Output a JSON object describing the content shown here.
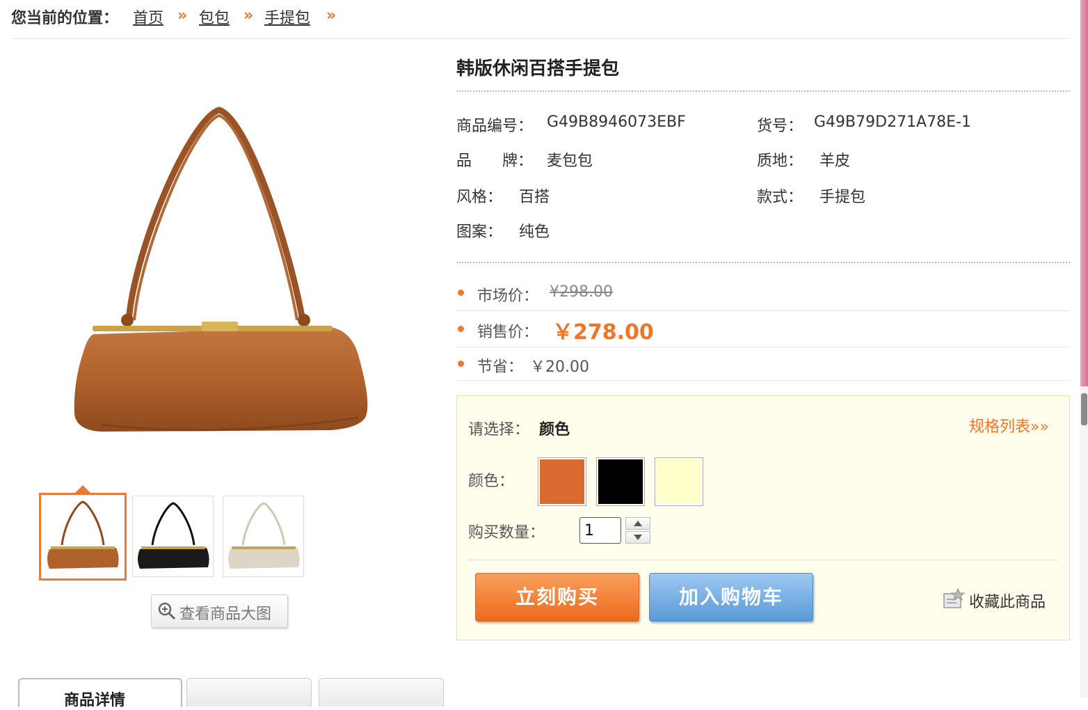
{
  "breadcrumb": {
    "label": "您当前的位置：",
    "items": [
      "首页",
      "包包",
      "手提包"
    ],
    "separator": "»"
  },
  "product": {
    "title": "韩版休闲百搭手提包",
    "attributes": [
      {
        "key": "商品编号：",
        "value": "G49B8946073EBF"
      },
      {
        "key": "货号：",
        "value": "G49B79D271A78E-1"
      },
      {
        "key": "品　　牌：",
        "value": "麦包包"
      },
      {
        "key": "质地：",
        "value": "羊皮"
      },
      {
        "key": "风格：",
        "value": "百搭"
      },
      {
        "key": "款式：",
        "value": "手提包"
      },
      {
        "key": "图案：",
        "value": "纯色"
      }
    ]
  },
  "prices": {
    "market_label": "市场价：",
    "market_value": "¥298.00",
    "sale_label": "销售价：",
    "sale_value": "￥278.00",
    "save_label": "节省：",
    "save_value": "￥20.00"
  },
  "options": {
    "choose_label": "请选择：",
    "choose_value": "颜色",
    "spec_link": "规格列表»»",
    "color_label": "颜色：",
    "colors": [
      "#d96a30",
      "#000000",
      "#ffffcc"
    ],
    "qty_label": "购买数量：",
    "qty_value": "1"
  },
  "actions": {
    "buy_now": "立刻购买",
    "add_cart": "加入购物车",
    "favorite": "收藏此商品",
    "view_large": "查看商品大图"
  },
  "tabs": [
    "商品详情"
  ],
  "colors": {
    "accent": "#f0752a",
    "option_bg": "#fffdeb"
  }
}
